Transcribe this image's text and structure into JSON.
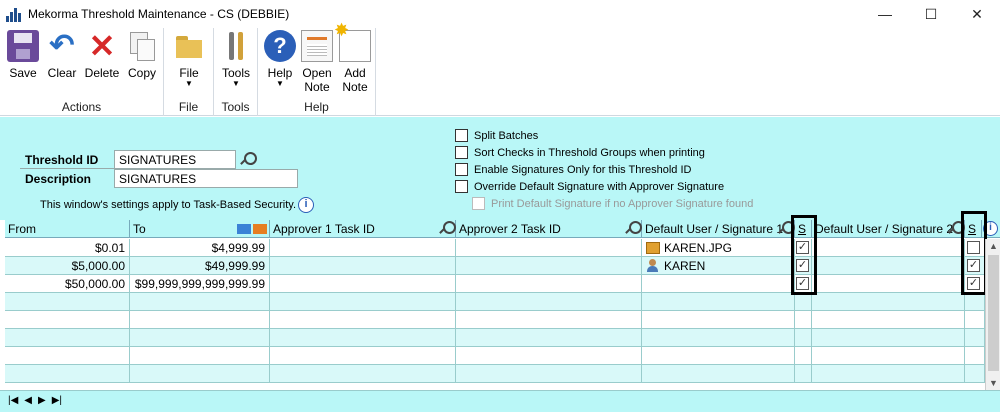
{
  "window": {
    "title": "Mekorma Threshold Maintenance  -  CS (DEBBIE)",
    "minimize": "—",
    "maximize": "☐",
    "close": "✕"
  },
  "ribbon": {
    "groups": {
      "actions": "Actions",
      "file": "File",
      "tools": "Tools",
      "help": "Help"
    },
    "buttons": {
      "save": "Save",
      "clear": "Clear",
      "delete": "Delete",
      "copy": "Copy",
      "file": "File",
      "tools": "Tools",
      "help": "Help",
      "open_note_1": "Open",
      "open_note_2": "Note",
      "add_note_1": "Add",
      "add_note_2": "Note"
    },
    "clear_glyph": "↶",
    "delete_glyph": "✕",
    "help_glyph": "?",
    "dropdown_glyph": "▼"
  },
  "form": {
    "threshold_id_label": "Threshold ID",
    "threshold_id_value": "SIGNATURES",
    "description_label": "Description",
    "description_value": "SIGNATURES",
    "security_note": "This window's settings apply to Task-Based Security.",
    "info_glyph": "i",
    "options": [
      {
        "label": "Split Batches",
        "checked": false,
        "enabled": true
      },
      {
        "label": "Sort Checks in Threshold Groups when printing",
        "checked": false,
        "enabled": true
      },
      {
        "label": "Enable Signatures Only for this Threshold ID",
        "checked": false,
        "enabled": true
      },
      {
        "label": "Override Default Signature with Approver Signature",
        "checked": false,
        "enabled": true
      },
      {
        "label": "Print Default Signature if no Approver Signature found",
        "checked": false,
        "enabled": false
      }
    ]
  },
  "grid": {
    "columns": {
      "from": "From",
      "to": "To",
      "approver1": "Approver 1 Task ID",
      "approver2": "Approver 2 Task ID",
      "sig1": "Default User / Signature 1",
      "s1": "S",
      "sig2": "Default User / Signature 2",
      "s2": "S"
    },
    "rows": [
      {
        "from": "$0.01",
        "to": "$4,999.99",
        "sig1": "KAREN.JPG",
        "sig1_icon": "image-file-icon",
        "s1": true,
        "s2": false
      },
      {
        "from": "$5,000.00",
        "to": "$49,999.99",
        "sig1": "KAREN",
        "sig1_icon": "user-icon",
        "s1": true,
        "s2": true
      },
      {
        "from": "$50,000.00",
        "to": "$99,999,999,999,999.99",
        "sig1": "",
        "sig1_icon": "",
        "s1": true,
        "s2": true
      },
      {
        "from": "",
        "to": "",
        "sig1": ""
      },
      {
        "from": "",
        "to": "",
        "sig1": ""
      },
      {
        "from": "",
        "to": "",
        "sig1": ""
      },
      {
        "from": "",
        "to": "",
        "sig1": ""
      },
      {
        "from": "",
        "to": "",
        "sig1": ""
      }
    ],
    "check_glyph": "✓",
    "scroll_up": "▲",
    "scroll_down": "▼"
  },
  "navigation": {
    "first": "|◀",
    "prev": "◀",
    "next": "▶",
    "last": "▶|"
  }
}
